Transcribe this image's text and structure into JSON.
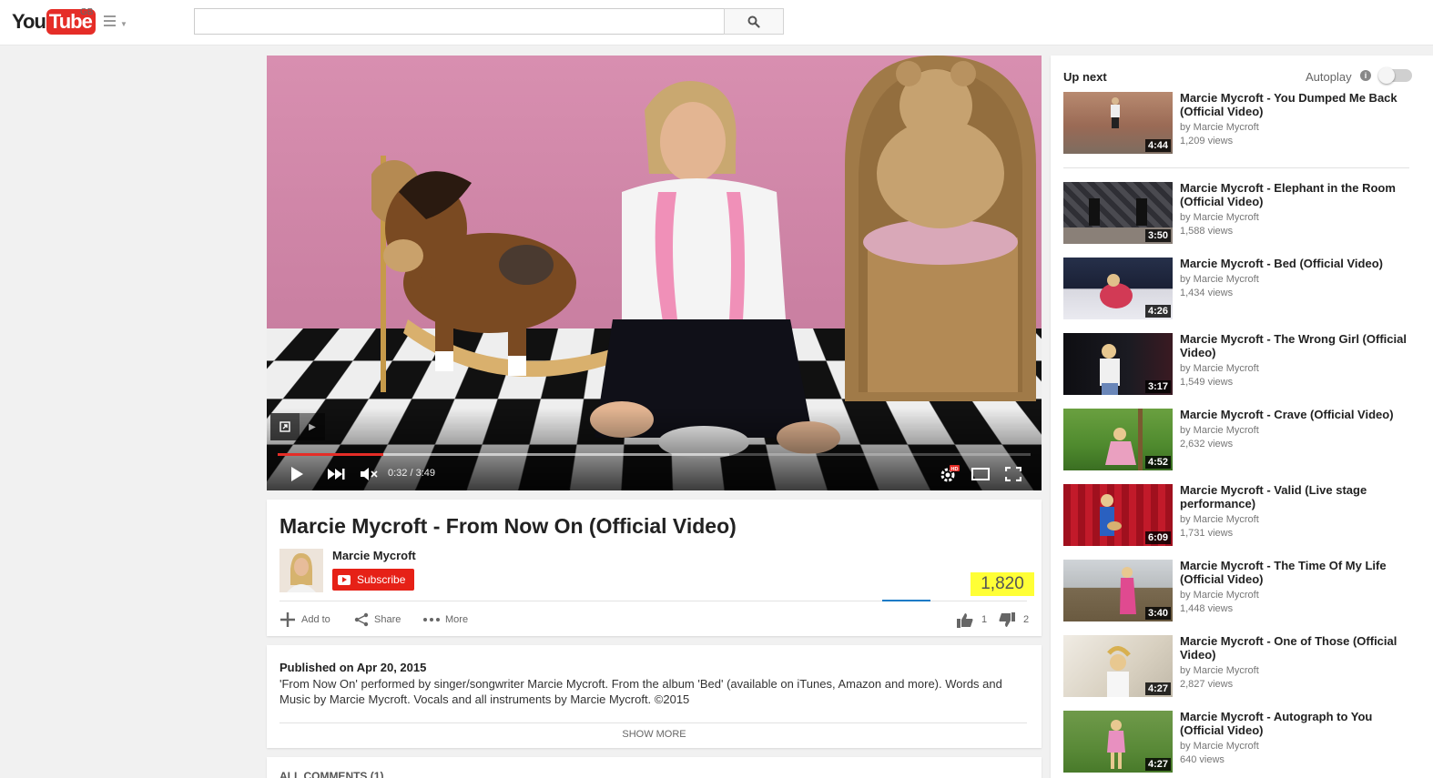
{
  "masthead": {
    "logo_you": "You",
    "logo_tube": "Tube",
    "region": "GB",
    "search_value": "",
    "search_placeholder": ""
  },
  "player": {
    "time": "0:32 / 3:49",
    "progress_played": 0.14,
    "progress_loaded": 0.6,
    "hd_badge": "HD",
    "icons": [
      "annotation-icon",
      "play-icon",
      "next-icon",
      "mute-icon",
      "settings-icon",
      "theater-icon",
      "fullscreen-icon"
    ]
  },
  "video": {
    "title": "Marcie Mycroft - From Now On (Official Video)",
    "channel": "Marcie Mycroft",
    "subscribe_label": "Subscribe",
    "views": "1,820",
    "actions": {
      "add_to": "Add to",
      "share": "Share",
      "more": "More"
    },
    "likes": "1",
    "dislikes": "2",
    "like_ratio": 0.33
  },
  "description": {
    "published": "Published on Apr 20, 2015",
    "text": "'From Now On' performed by singer/songwriter Marcie Mycroft. From the album 'Bed' (available on iTunes, Amazon and more). Words and Music by Marcie Mycroft. Vocals and all instruments by Marcie Mycroft. ©2015",
    "show_more": "SHOW MORE"
  },
  "comments": {
    "header": "ALL COMMENTS (1)"
  },
  "sidebar": {
    "up_next": "Up next",
    "autoplay": "Autoplay",
    "videos": [
      {
        "title": "Marcie Mycroft - You Dumped Me Back (Official Video)",
        "channel": "by Marcie Mycroft",
        "views": "1,209 views",
        "duration": "4:44"
      },
      {
        "title": "Marcie Mycroft - Elephant in the Room (Official Video)",
        "channel": "by Marcie Mycroft",
        "views": "1,588 views",
        "duration": "3:50"
      },
      {
        "title": "Marcie Mycroft - Bed (Official Video)",
        "channel": "by Marcie Mycroft",
        "views": "1,434 views",
        "duration": "4:26"
      },
      {
        "title": "Marcie Mycroft - The Wrong Girl (Official Video)",
        "channel": "by Marcie Mycroft",
        "views": "1,549 views",
        "duration": "3:17"
      },
      {
        "title": "Marcie Mycroft - Crave (Official Video)",
        "channel": "by Marcie Mycroft",
        "views": "2,632 views",
        "duration": "4:52"
      },
      {
        "title": "Marcie Mycroft - Valid (Live stage performance)",
        "channel": "by Marcie Mycroft",
        "views": "1,731 views",
        "duration": "6:09"
      },
      {
        "title": "Marcie Mycroft - The Time Of My Life (Official Video)",
        "channel": "by Marcie Mycroft",
        "views": "1,448 views",
        "duration": "3:40"
      },
      {
        "title": "Marcie Mycroft - One of Those (Official Video)",
        "channel": "by Marcie Mycroft",
        "views": "2,827 views",
        "duration": "4:27"
      },
      {
        "title": "Marcie Mycroft - Autograph to You (Official Video)",
        "channel": "by Marcie Mycroft",
        "views": "640 views",
        "duration": "4:27"
      }
    ]
  },
  "colors": {
    "brand_red": "#e52d27",
    "subscribe_red": "#e62117",
    "highlight_yellow": "#ffff36",
    "sentiment_blue": "#167ac6"
  }
}
